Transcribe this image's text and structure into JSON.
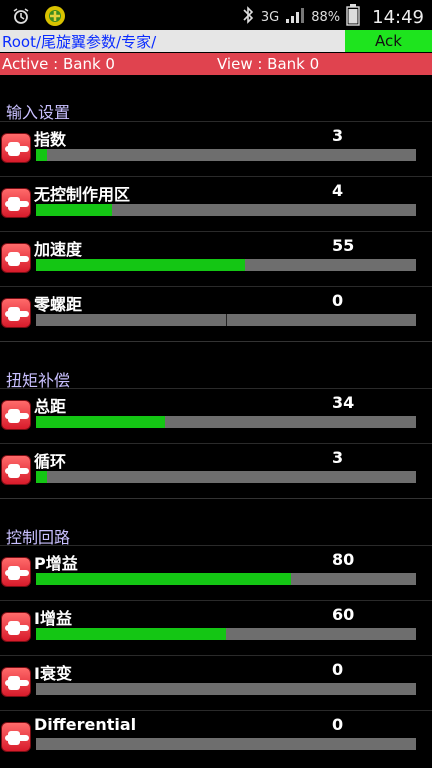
{
  "statusbar": {
    "alarm_icon": "alarm-clock-icon",
    "app_icon": "app-notification-icon",
    "bluetooth_icon": "bluetooth-icon",
    "network_type": "3G",
    "battery_percent": "88%",
    "time": "14:49"
  },
  "header": {
    "path": "Root/尾旋翼参数/专家/",
    "ack_label": "Ack",
    "active_bank": "Active : Bank 0",
    "view_bank": "View : Bank 0"
  },
  "sections": [
    {
      "title": "输入设置",
      "items": [
        {
          "label": "指数",
          "value": "3",
          "level": 0.03
        },
        {
          "label": "无控制作用区",
          "value": "4",
          "level": 0.2
        },
        {
          "label": "加速度",
          "value": "55",
          "level": 0.55
        },
        {
          "label": "零螺距",
          "value": "0",
          "level": 0,
          "center_tick": true
        }
      ]
    },
    {
      "title": "扭矩补偿",
      "items": [
        {
          "label": "总距",
          "value": "34",
          "level": 0.34
        },
        {
          "label": "循环",
          "value": "3",
          "level": 0.03
        }
      ]
    },
    {
      "title": "控制回路",
      "items": [
        {
          "label": "P增益",
          "value": "80",
          "level": 0.67
        },
        {
          "label": "I增益",
          "value": "60",
          "level": 0.5
        },
        {
          "label": "I衰变",
          "value": "0",
          "level": 0
        },
        {
          "label": "Differential",
          "value": "0",
          "level": 0
        }
      ]
    }
  ]
}
